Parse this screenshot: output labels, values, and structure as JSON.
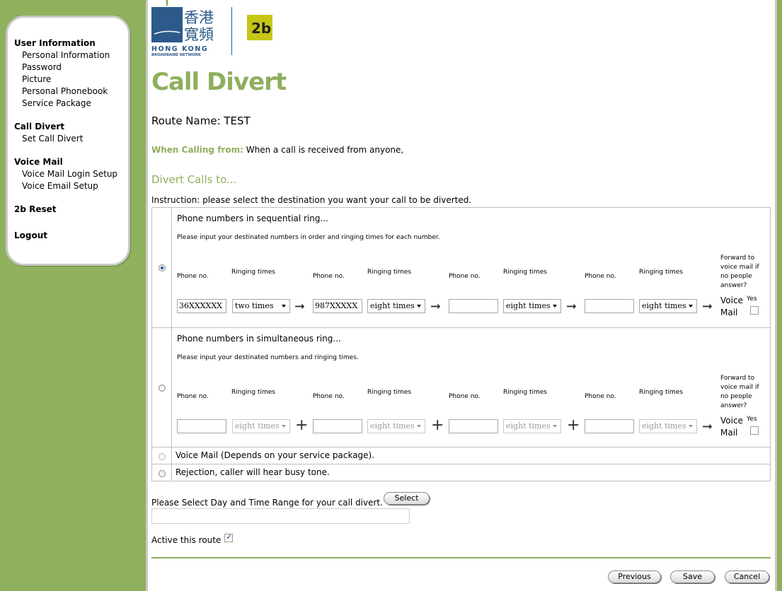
{
  "sidebar": {
    "groups": [
      {
        "title": "User Information",
        "items": [
          "Personal Information",
          "Password",
          "Picture",
          "Personal Phonebook",
          "Service Package"
        ]
      },
      {
        "title": "Call Divert",
        "items": [
          "Set Call Divert"
        ]
      },
      {
        "title": "Voice Mail",
        "items": [
          "Voice Mail Login Setup",
          "Voice Email Setup"
        ]
      },
      {
        "title": "2b Reset",
        "items": []
      },
      {
        "title": "Logout",
        "items": []
      }
    ]
  },
  "logo": {
    "chinese": "香港寬頻",
    "line1": "HONG KONG",
    "line2": "BROADBAND NETWORK",
    "badge": "2b"
  },
  "page": {
    "title": "Call Divert",
    "route_name": "Route Name: TEST",
    "calling_from_label": "When Calling from:",
    "calling_from_value": "When a call is received from anyone,",
    "divert_heading": "Divert Calls to...",
    "instruction": "Instruction: please select the destination you want your call to be diverted."
  },
  "headers": {
    "phone_no": "Phone no.",
    "ringing_times": "Ringing times",
    "forward": "Forward to voice mail if no people answer?",
    "voice_mail": "Voice Mail",
    "yes": "Yes"
  },
  "sequential": {
    "title": "Phone numbers in sequential ring...",
    "subtitle": "Please input your destinated numbers in order and ringing times for each number.",
    "phones": [
      "36XXXXXX",
      "987XXXXX",
      "",
      ""
    ],
    "ringing": [
      "two times",
      "eight times",
      "eight times",
      "eight times"
    ]
  },
  "simultaneous": {
    "title": "Phone numbers in simultaneous ring...",
    "subtitle": "Please input your destinated numbers and ringing times.",
    "phones": [
      "",
      "",
      "",
      ""
    ],
    "ringing": [
      "eight times",
      "eight times",
      "eight times",
      "eight times"
    ]
  },
  "voice_mail_option": "Voice Mail (Depends on your service package).",
  "rejection_option": "Rejection, caller will hear busy tone.",
  "time_range_label": "Please Select Day and Time Range for your call divert.",
  "select_button": "Select",
  "active_route_label": "Active this route",
  "buttons": {
    "previous": "Previous",
    "save": "Save",
    "cancel": "Cancel"
  },
  "colors": {
    "page_bg": "#8fb05c",
    "accent": "#8faf5d",
    "brand_blue": "#2c5a8a",
    "badge": "#c7c617"
  }
}
